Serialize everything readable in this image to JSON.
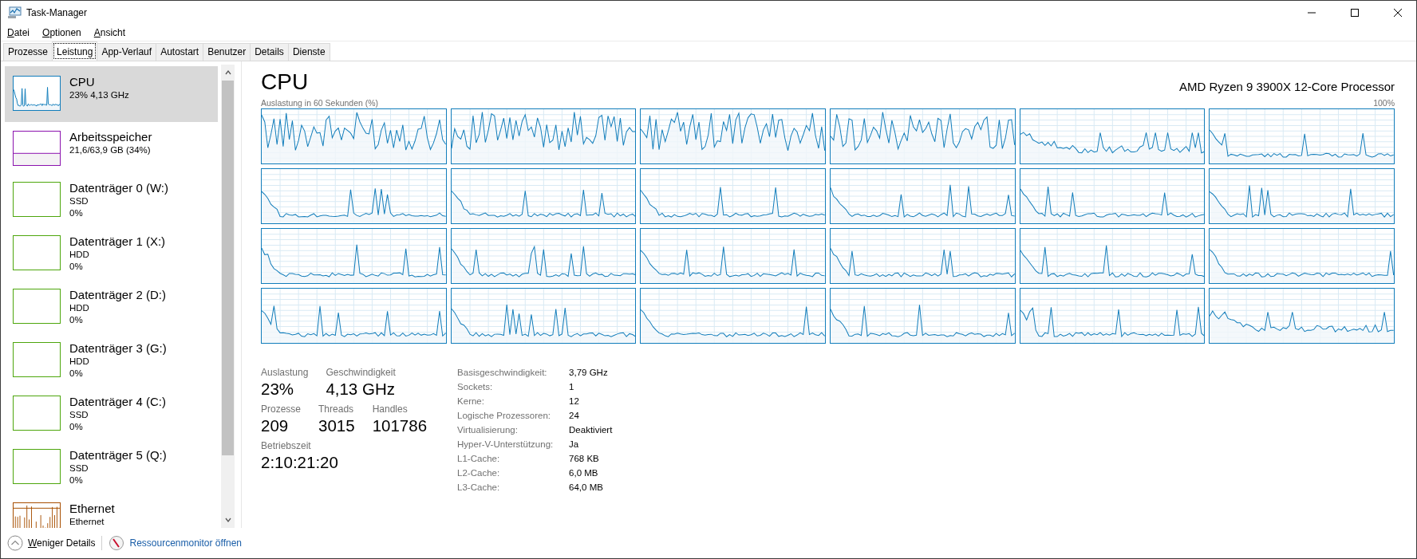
{
  "window": {
    "title": "Task-Manager"
  },
  "menu": [
    "Datei",
    "Optionen",
    "Ansicht"
  ],
  "tabs": [
    {
      "label": "Prozesse",
      "selected": false
    },
    {
      "label": "Leistung",
      "selected": true
    },
    {
      "label": "App-Verlauf",
      "selected": false
    },
    {
      "label": "Autostart",
      "selected": false
    },
    {
      "label": "Benutzer",
      "selected": false
    },
    {
      "label": "Details",
      "selected": false
    },
    {
      "label": "Dienste",
      "selected": false
    }
  ],
  "sidebar": {
    "items": [
      {
        "kind": "cpu",
        "name": "CPU",
        "lines": [
          "23% 4,13 GHz"
        ],
        "color": "#117dbb",
        "selected": true
      },
      {
        "kind": "memory",
        "name": "Arbeitsspeicher",
        "lines": [
          "21,6/63,9 GB (34%)"
        ],
        "color": "#8b12ae",
        "selected": false
      },
      {
        "kind": "disk",
        "name": "Datenträger 0 (W:)",
        "lines": [
          "SSD",
          "0%"
        ],
        "color": "#4da60c",
        "selected": false
      },
      {
        "kind": "disk",
        "name": "Datenträger 1 (X:)",
        "lines": [
          "HDD",
          "0%"
        ],
        "color": "#4da60c",
        "selected": false
      },
      {
        "kind": "disk",
        "name": "Datenträger 2 (D:)",
        "lines": [
          "HDD",
          "0%"
        ],
        "color": "#4da60c",
        "selected": false
      },
      {
        "kind": "disk",
        "name": "Datenträger 3 (G:)",
        "lines": [
          "HDD",
          "0%"
        ],
        "color": "#4da60c",
        "selected": false
      },
      {
        "kind": "disk",
        "name": "Datenträger 4 (C:)",
        "lines": [
          "SSD",
          "0%"
        ],
        "color": "#4da60c",
        "selected": false
      },
      {
        "kind": "disk",
        "name": "Datenträger 5 (Q:)",
        "lines": [
          "SSD",
          "0%"
        ],
        "color": "#4da60c",
        "selected": false
      },
      {
        "kind": "ethernet",
        "name": "Ethernet",
        "lines": [
          "Ethernet"
        ],
        "color": "#a74f01",
        "selected": false
      }
    ]
  },
  "main": {
    "title": "CPU",
    "processor": "AMD Ryzen 9 3900X 12-Core Processor",
    "graph_label": "Auslastung in 60 Sekunden (%)",
    "graph_max": "100%",
    "core_graphs": [
      {
        "kind": "busy"
      },
      {
        "kind": "busy"
      },
      {
        "kind": "busy"
      },
      {
        "kind": "busy"
      },
      {
        "kind": "medium"
      },
      {
        "kind": "idle"
      },
      {
        "kind": "idle"
      },
      {
        "kind": "idle"
      },
      {
        "kind": "idle"
      },
      {
        "kind": "idle"
      },
      {
        "kind": "idle"
      },
      {
        "kind": "idle"
      },
      {
        "kind": "idle"
      },
      {
        "kind": "idle"
      },
      {
        "kind": "idle"
      },
      {
        "kind": "idle"
      },
      {
        "kind": "idle"
      },
      {
        "kind": "idle"
      },
      {
        "kind": "idle"
      },
      {
        "kind": "idle"
      },
      {
        "kind": "idle"
      },
      {
        "kind": "idle"
      },
      {
        "kind": "idle"
      },
      {
        "kind": "medium"
      }
    ],
    "stat_rows": [
      [
        {
          "label": "Auslastung",
          "value": "23%"
        },
        {
          "label": "Geschwindigkeit",
          "value": "4,13 GHz"
        }
      ],
      [
        {
          "label": "Prozesse",
          "value": "209"
        },
        {
          "label": "Threads",
          "value": "3015"
        },
        {
          "label": "Handles",
          "value": "101786"
        }
      ],
      [
        {
          "label": "Betriebszeit",
          "value": "2:10:21:20"
        }
      ]
    ],
    "details": [
      {
        "label": "Basisgeschwindigkeit:",
        "value": "3,79 GHz"
      },
      {
        "label": "Sockets:",
        "value": "1"
      },
      {
        "label": "Kerne:",
        "value": "12"
      },
      {
        "label": "Logische Prozessoren:",
        "value": "24"
      },
      {
        "label": "Virtualisierung:",
        "value": "Deaktiviert"
      },
      {
        "label": "Hyper-V-Unterstützung:",
        "value": "Ja"
      },
      {
        "label": "L1-Cache:",
        "value": "768 KB"
      },
      {
        "label": "L2-Cache:",
        "value": "6,0 MB"
      },
      {
        "label": "L3-Cache:",
        "value": "64,0 MB"
      }
    ]
  },
  "footer": {
    "less_details": "Weniger Details",
    "resource_monitor": "Ressourcenmonitor öffnen"
  }
}
